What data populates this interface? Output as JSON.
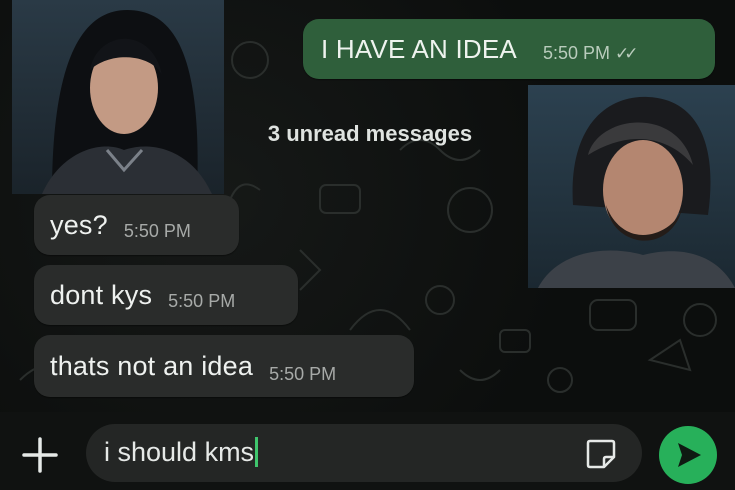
{
  "conversation": {
    "messages": [
      {
        "direction": "outgoing",
        "text": "I HAVE AN IDEA",
        "time": "5:50 PM",
        "status": "read-double-check"
      },
      {
        "direction": "incoming",
        "text": "yes?",
        "time": "5:50 PM"
      },
      {
        "direction": "incoming",
        "text": "dont kys",
        "time": "5:50 PM"
      },
      {
        "direction": "incoming",
        "text": "thats not an idea",
        "time": "5:50 PM"
      }
    ],
    "unread_divider": "3 unread messages"
  },
  "composer": {
    "input_value": "i should kms",
    "icons": {
      "attach": "plus-icon",
      "sticker": "sticker-icon",
      "send": "send-icon"
    }
  },
  "colors": {
    "outgoing_bubble": "#2f5f3b",
    "incoming_bubble": "#2a2c2b",
    "send_button": "#27b05a",
    "background": "#0c0e0d"
  }
}
